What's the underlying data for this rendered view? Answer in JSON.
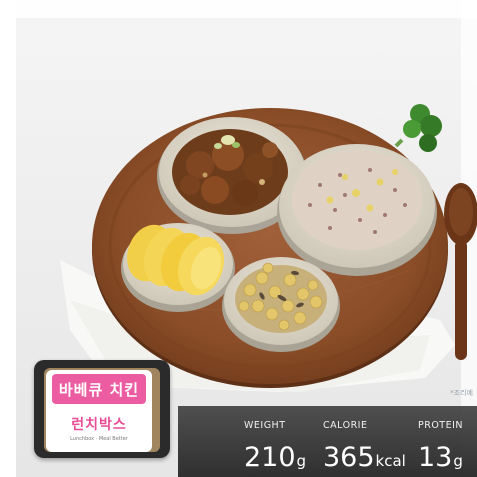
{
  "photo": {
    "background_color": "#eeeeee",
    "tray_color": "#8a4d27",
    "caption": "*조리예"
  },
  "product": {
    "name": "바베큐 치킨",
    "brand": "런치박스",
    "subtitle": "Lunchbox · Meal Better",
    "accent_color": "#ec5ca1"
  },
  "nutrition": [
    {
      "label": "WEIGHT",
      "value": "210",
      "unit": "g"
    },
    {
      "label": "CALORIE",
      "value": "365",
      "unit": "kcal"
    },
    {
      "label": "PROTEIN",
      "value": "13",
      "unit": "g"
    }
  ]
}
